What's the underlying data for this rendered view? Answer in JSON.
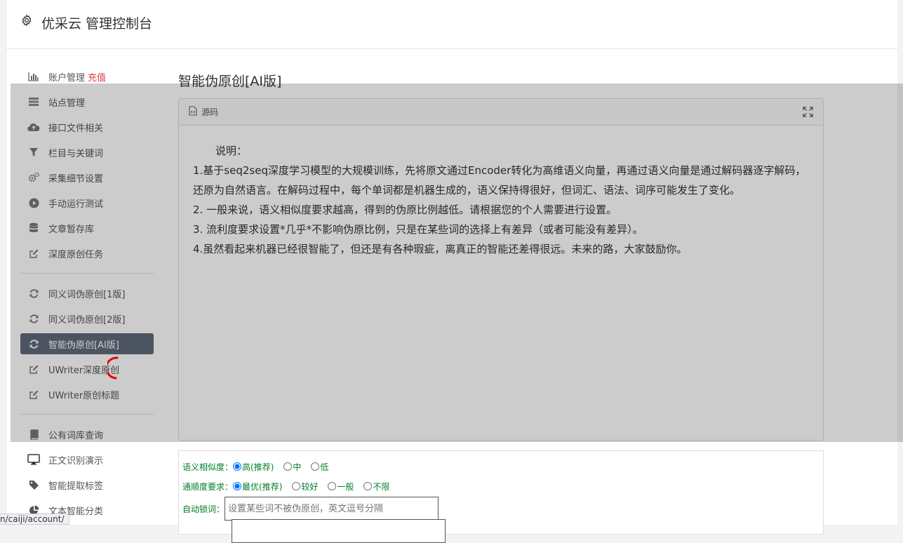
{
  "header": {
    "title": "优采云 管理控制台",
    "icon": "gear-icon"
  },
  "sidebar": {
    "items": [
      {
        "label": "账户管理",
        "badge": "充值",
        "icon": "bar-chart-icon"
      },
      {
        "label": "站点管理",
        "icon": "server-icon"
      },
      {
        "label": "接口文件相关",
        "icon": "cloud-upload-icon"
      },
      {
        "label": "栏目与关键词",
        "icon": "filter-icon"
      },
      {
        "label": "采集细节设置",
        "icon": "cogs-icon"
      },
      {
        "label": "手动运行测试",
        "icon": "play-circle-icon"
      },
      {
        "label": "文章暂存库",
        "icon": "database-icon"
      },
      {
        "label": "深度原创任务",
        "icon": "edit-icon"
      },
      {
        "label": "同义词伪原创[1版]",
        "icon": "refresh-icon"
      },
      {
        "label": "同义词伪原创[2版]",
        "icon": "refresh-icon"
      },
      {
        "label": "智能伪原创[AI版]",
        "icon": "refresh-icon",
        "active": true
      },
      {
        "label": "UWriter深度原创",
        "icon": "edit-icon"
      },
      {
        "label": "UWriter原创标题",
        "icon": "edit-icon"
      },
      {
        "label": "公有词库查询",
        "icon": "book-icon"
      },
      {
        "label": "正文识别演示",
        "icon": "desktop-icon"
      },
      {
        "label": "智能提取标签",
        "icon": "tag-icon"
      },
      {
        "label": "文本智能分类",
        "icon": "pie-chart-icon"
      }
    ]
  },
  "main": {
    "title": "智能伪原创[AI版]",
    "panel": {
      "header": "源码",
      "lines": [
        "说明：",
        "1.基于seq2seq深度学习模型的大规模训练，先将原文通过Encoder转化为高维语义向量，再通过语义向量是通过解码器逐字解码，还原为自然语言。在解码过程中，每个单词都是机器生成的，语义保持得很好，但词汇、语法、词序可能发生了变化。",
        "2. 一般来说，语义相似度要求越高，得到的伪原比例越低。请根据您的个人需要进行设置。",
        "3. 流利度要求设置*几乎*不影响伪原比例，只是在某些词的选择上有差异（或者可能没有差异）。",
        "4.虽然看起来机器已经很智能了，但还是有各种瑕疵，离真正的智能还差得很远。未来的路，大家鼓励你。"
      ]
    },
    "form": {
      "similarity_label": "语义相似度：",
      "similarity_options": [
        "高(推荐)",
        "中",
        "低"
      ],
      "similarity_selected": "高(推荐)",
      "fluency_label": "通顺度要求：",
      "fluency_options": [
        "最优(推荐)",
        "较好",
        "一般",
        "不限"
      ],
      "fluency_selected": "最优(推荐)",
      "lock_label": "自动锁词：",
      "lock_placeholder": "设置某些词不被伪原创，英文逗号分隔"
    }
  },
  "statusbar": {
    "url": "n/caiji/account/"
  },
  "colors": {
    "active_bg": "#5f6a7a",
    "recharge": "#e4393c",
    "form_label": "#00802b",
    "spinner": "#e60000"
  }
}
